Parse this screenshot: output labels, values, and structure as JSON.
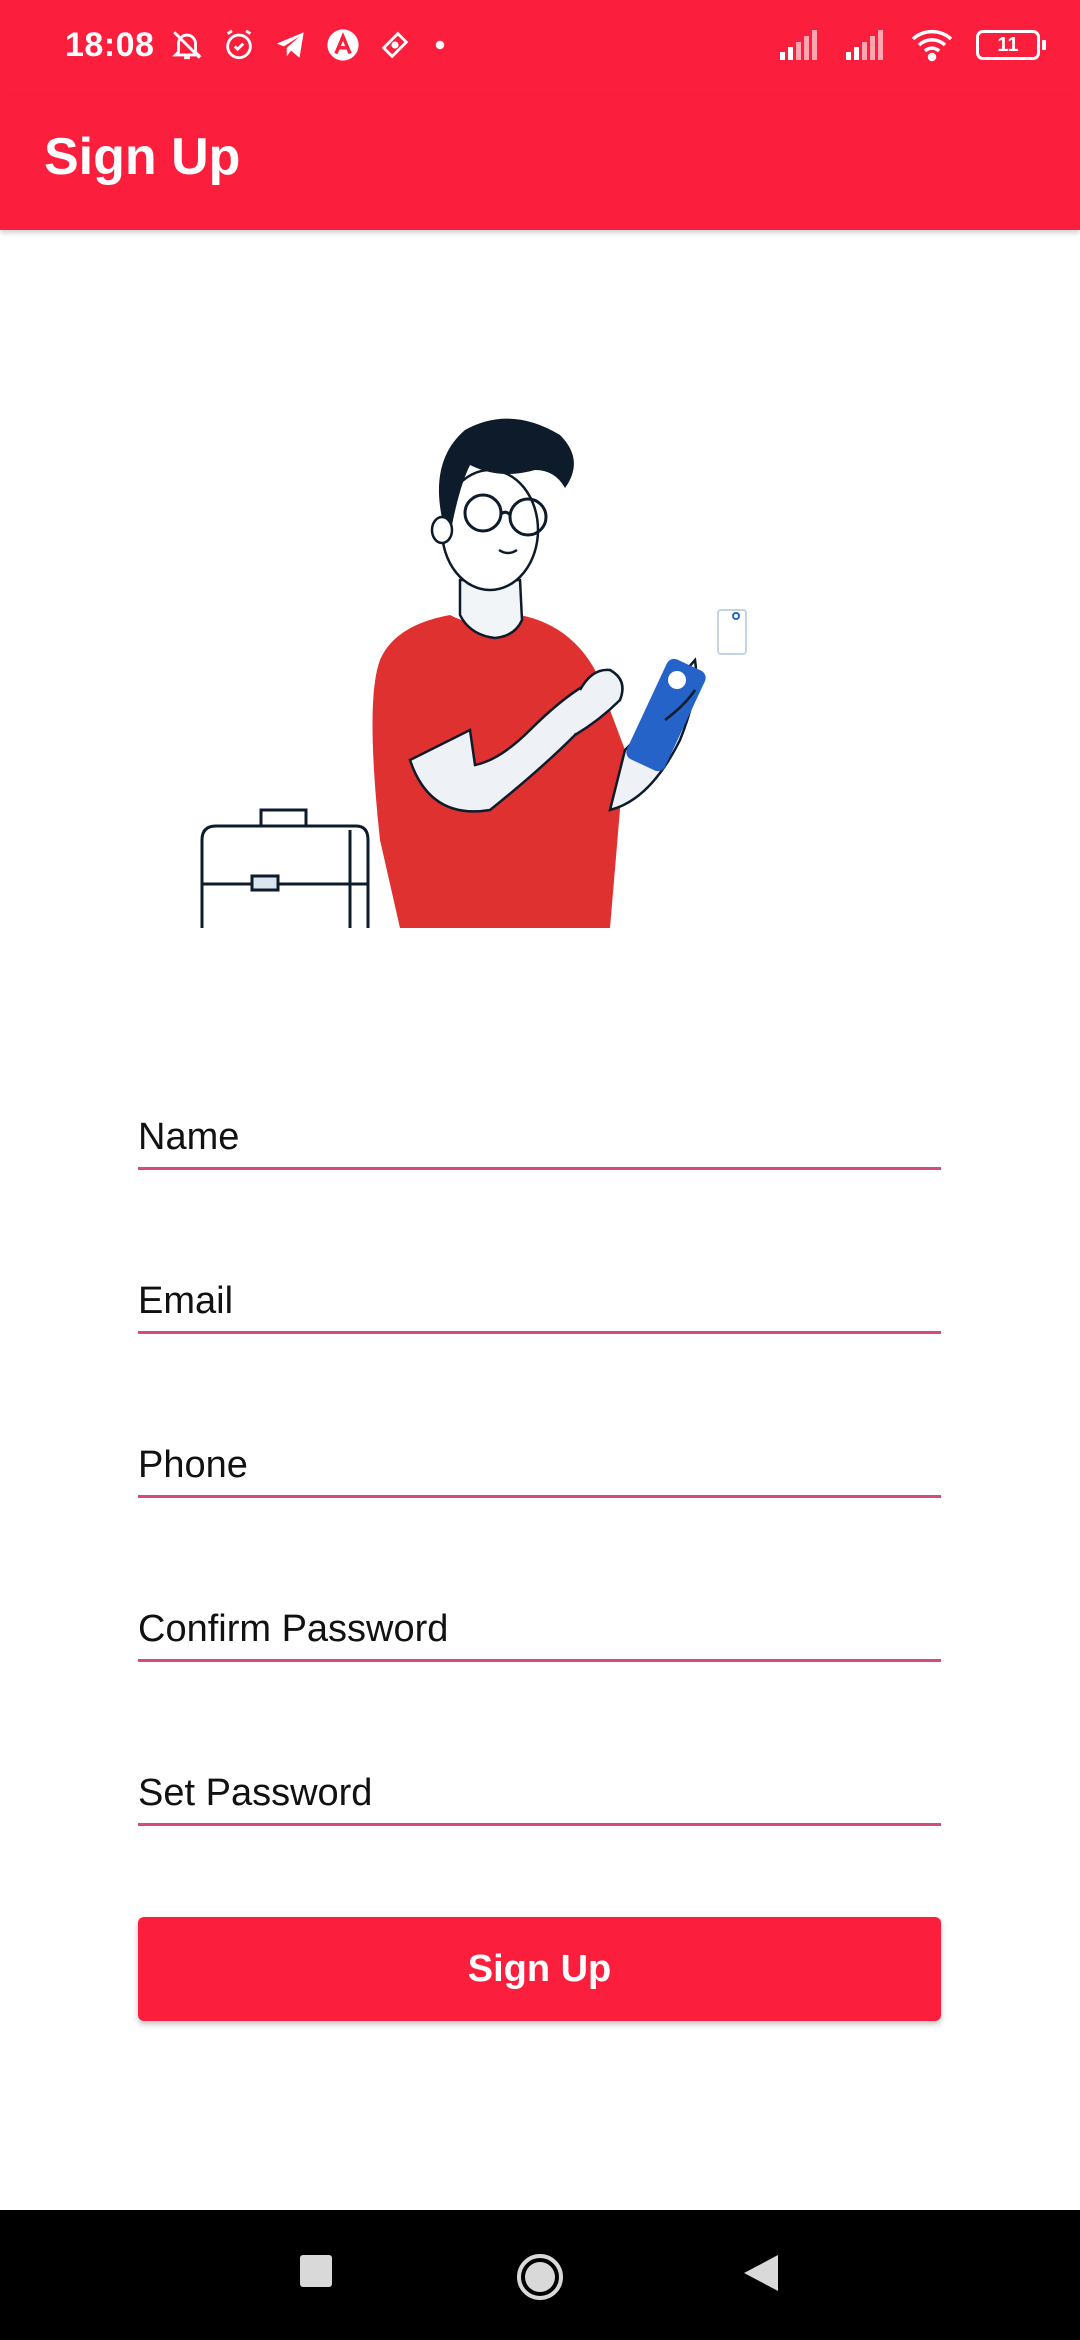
{
  "status_bar": {
    "time": "18:08",
    "battery": "11",
    "icons_left": [
      "bell-off-icon",
      "alarm-icon",
      "telegram-icon",
      "app-a-icon",
      "ticket-icon",
      "dot-icon"
    ],
    "icons_right": [
      "signal-icon",
      "signal-icon",
      "wifi-icon",
      "battery-icon"
    ]
  },
  "app_bar": {
    "title": "Sign Up"
  },
  "form": {
    "name_placeholder": "Name",
    "email_placeholder": "Email",
    "phone_placeholder": "Phone",
    "confirm_password_placeholder": "Confirm Password",
    "set_password_placeholder": "Set Password",
    "submit_label": "Sign Up"
  },
  "colors": {
    "primary": "#fc1e3d",
    "underline": "#d84a75",
    "shirt": "#e03131",
    "phone": "#2563c9"
  },
  "nav_bar": {
    "buttons": [
      "recents-square-icon",
      "home-circle-icon",
      "back-triangle-icon"
    ]
  }
}
